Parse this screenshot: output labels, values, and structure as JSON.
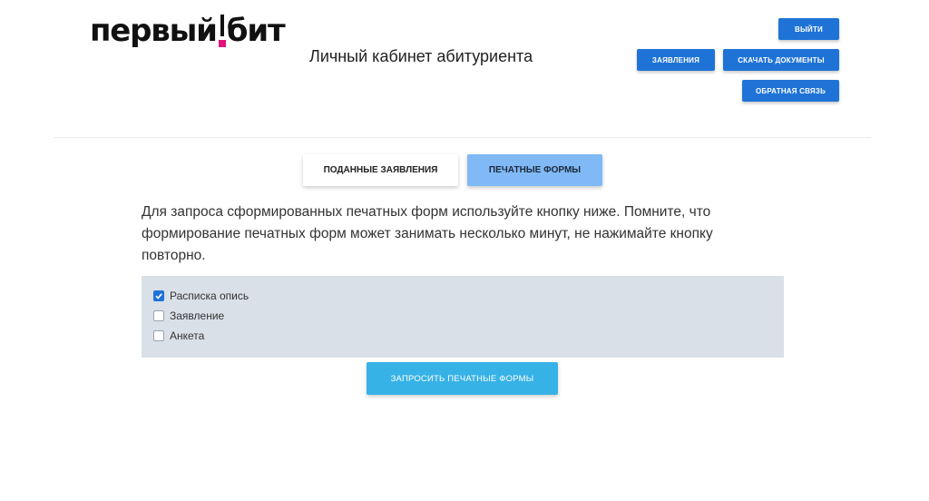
{
  "header": {
    "logo": {
      "left": "первый",
      "right": "бит",
      "accent_color": "#e0147a"
    },
    "title": "Личный кабинет абитуриента"
  },
  "nav_buttons": {
    "exit": "Выйти",
    "applications": "Заявления",
    "download_documents": "Скачать документы",
    "feedback": "Обратная связь"
  },
  "tabs": [
    {
      "label": "Поданные заявления",
      "active": false
    },
    {
      "label": "Печатные формы",
      "active": true
    }
  ],
  "info_text": "Для запроса сформированных печатных форм используйте кнопку ниже. Помните, что формирование печатных форм может занимать несколько минут, не нажимайте кнопку повторно.",
  "forms": [
    {
      "label": "Расписка опись",
      "checked": true
    },
    {
      "label": "Заявление",
      "checked": false
    },
    {
      "label": "Анкета",
      "checked": false
    }
  ],
  "request_button": "Запросить печатные формы",
  "colors": {
    "primary": "#1f73d6",
    "active_tab": "#80b9f5",
    "panel_bg": "#dae0e7",
    "request_button": "#36b2e6"
  }
}
